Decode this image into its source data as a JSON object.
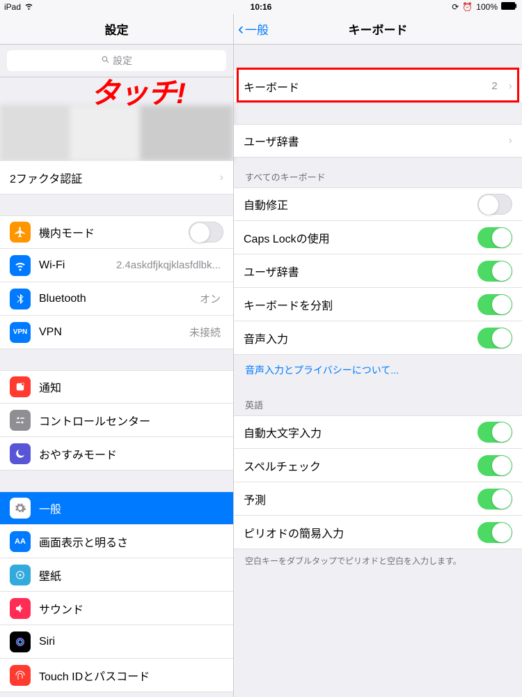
{
  "status": {
    "device": "iPad",
    "time": "10:16",
    "battery": "100%"
  },
  "annotation": "タッチ!",
  "sidebar": {
    "title": "設定",
    "search_placeholder": "設定",
    "two_factor": "2ファクタ認証",
    "group1": {
      "airplane": "機内モード",
      "wifi": "Wi-Fi",
      "wifi_value": "2.4askdfjkqjklasfdlbk...",
      "bluetooth": "Bluetooth",
      "bluetooth_value": "オン",
      "vpn": "VPN",
      "vpn_value": "未接続"
    },
    "group2": {
      "notifications": "通知",
      "control_center": "コントロールセンター",
      "dnd": "おやすみモード"
    },
    "group3": {
      "general": "一般",
      "display": "画面表示と明るさ",
      "wallpaper": "壁紙",
      "sound": "サウンド",
      "siri": "Siri",
      "touchid": "Touch IDとパスコード"
    }
  },
  "detail": {
    "back": "一般",
    "title": "キーボード",
    "keyboards_row": {
      "label": "キーボード",
      "count": "2"
    },
    "user_dict": "ユーザ辞書",
    "sect_all": "すべてのキーボード",
    "auto_correct": "自動修正",
    "caps_lock": "Caps Lockの使用",
    "user_dict2": "ユーザ辞書",
    "split_kb": "キーボードを分割",
    "dictation": "音声入力",
    "dictation_privacy": "音声入力とプライバシーについて...",
    "sect_eng": "英語",
    "auto_cap": "自動大文字入力",
    "spell_check": "スペルチェック",
    "prediction": "予測",
    "period_shortcut": "ピリオドの簡易入力",
    "period_footer": "空白キーをダブルタップでピリオドと空白を入力します。"
  }
}
